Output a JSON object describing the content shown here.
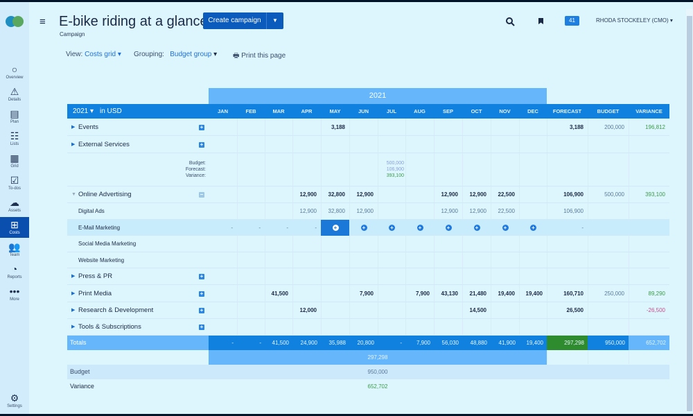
{
  "app": {
    "title": "E-bike riding at a glance",
    "subtitle": "Campaign",
    "create_label": "Create campaign",
    "notifications": "41",
    "user": "RHODA STOCKELEY (CMO)"
  },
  "sidebar": {
    "items": [
      {
        "label": "Overview",
        "icon": "○"
      },
      {
        "label": "Details",
        "icon": "⚠"
      },
      {
        "label": "Plan",
        "icon": "▤"
      },
      {
        "label": "Lists",
        "icon": "☷"
      },
      {
        "label": "Grid",
        "icon": "▦"
      },
      {
        "label": "To-dos",
        "icon": "☑"
      },
      {
        "label": "Assets",
        "icon": "☁"
      },
      {
        "label": "Costs",
        "icon": "⊞"
      },
      {
        "label": "Team",
        "icon": "👥"
      },
      {
        "label": "Reports",
        "icon": "◔"
      },
      {
        "label": "More",
        "icon": "•••"
      }
    ],
    "settings": {
      "label": "Settings",
      "icon": "⚙"
    }
  },
  "toolbar": {
    "view_label": "View:",
    "view_value": "Costs grid",
    "grouping_label": "Grouping:",
    "grouping_value": "Budget group",
    "print_label": "Print this page"
  },
  "grid": {
    "year": "2021",
    "year_select": "2021",
    "currency": "in USD",
    "columns": [
      "JAN",
      "FEB",
      "MAR",
      "APR",
      "MAY",
      "JUN",
      "JUL",
      "AUG",
      "SEP",
      "OCT",
      "NOV",
      "DEC",
      "FORECAST",
      "BUDGET",
      "VARIANCE"
    ],
    "rows": [
      {
        "name": "Events",
        "type": "group",
        "values": [
          "",
          "",
          "",
          "",
          "3,188",
          "",
          "",
          "",
          "",
          "",
          "",
          "",
          "3,188",
          "200,000",
          "196,812"
        ]
      },
      {
        "name": "External Services",
        "type": "group",
        "values": [
          "",
          "",
          "",
          "",
          "",
          "",
          "",
          "",
          "",
          "",
          "",
          "",
          "",
          "",
          ""
        ]
      },
      {
        "name": "Online Advertising",
        "type": "group-open",
        "values": [
          "",
          "",
          "",
          "12,900",
          "32,800",
          "12,900",
          "",
          "",
          "12,900",
          "12,900",
          "22,500",
          "",
          "106,900",
          "500,000",
          "393,100"
        ]
      },
      {
        "name": "Digital Ads",
        "type": "child",
        "values": [
          "",
          "",
          "",
          "12,900",
          "32,800",
          "12,900",
          "",
          "",
          "12,900",
          "12,900",
          "22,500",
          "",
          "106,900",
          "",
          ""
        ]
      },
      {
        "name": "E-Mail Marketing",
        "type": "child-active",
        "values": [
          "-",
          "-",
          "-",
          "-",
          "",
          "",
          "",
          "",
          "",
          "",
          "",
          "",
          "-",
          "",
          ""
        ]
      },
      {
        "name": "Social Media Marketing",
        "type": "child",
        "values": [
          "",
          "",
          "",
          "",
          "",
          "",
          "",
          "",
          "",
          "",
          "",
          "",
          "",
          "",
          ""
        ]
      },
      {
        "name": "Website Marketing",
        "type": "child",
        "values": [
          "",
          "",
          "",
          "",
          "",
          "",
          "",
          "",
          "",
          "",
          "",
          "",
          "",
          "",
          ""
        ]
      },
      {
        "name": "Press & PR",
        "type": "group",
        "values": [
          "",
          "",
          "",
          "",
          "",
          "",
          "",
          "",
          "",
          "",
          "",
          "",
          "",
          "",
          ""
        ]
      },
      {
        "name": "Print Media",
        "type": "group",
        "values": [
          "",
          "",
          "41,500",
          "",
          "",
          "7,900",
          "",
          "7,900",
          "43,130",
          "21,480",
          "19,400",
          "19,400",
          "160,710",
          "250,000",
          "89,290"
        ]
      },
      {
        "name": "Research & Development",
        "type": "group",
        "values": [
          "",
          "",
          "",
          "12,000",
          "",
          "",
          "",
          "",
          "",
          "14,500",
          "",
          "",
          "26,500",
          "",
          "-26,500"
        ]
      },
      {
        "name": "Tools & Subscriptions",
        "type": "group",
        "values": [
          "",
          "",
          "",
          "",
          "",
          "",
          "",
          "",
          "",
          "",
          "",
          "",
          "",
          "",
          ""
        ]
      }
    ],
    "summary": {
      "budget_label": "Budget:",
      "forecast_label": "Forecast:",
      "variance_label": "Variance:",
      "budget": "500,000",
      "forecast": "106,900",
      "variance": "393,100"
    },
    "totals": {
      "label": "Totals",
      "values": [
        "-",
        "-",
        "41,500",
        "24,900",
        "35,988",
        "20,800",
        "-",
        "7,900",
        "56,030",
        "48,880",
        "41,900",
        "19,400",
        "297,298",
        "950,000",
        "652,702"
      ],
      "year_total": "297,298"
    },
    "footer": {
      "budget_label": "Budget",
      "budget_value": "950,000",
      "variance_label": "Variance",
      "variance_value": "652,702"
    }
  }
}
